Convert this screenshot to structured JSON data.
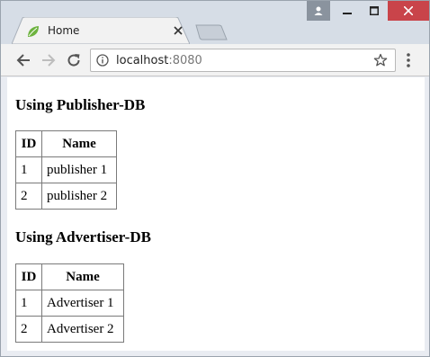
{
  "browser": {
    "tab_title": "Home",
    "url_host": "localhost",
    "url_port": ":8080"
  },
  "sections": [
    {
      "heading": "Using Publisher-DB",
      "columns": [
        "ID",
        "Name"
      ],
      "rows": [
        [
          "1",
          "publisher 1"
        ],
        [
          "2",
          "publisher 2"
        ]
      ]
    },
    {
      "heading": "Using Advertiser-DB",
      "columns": [
        "ID",
        "Name"
      ],
      "rows": [
        [
          "1",
          "Advertiser 1"
        ],
        [
          "2",
          "Advertiser 2"
        ]
      ]
    }
  ],
  "icons": {
    "favicon": "leaf-icon",
    "back": "arrow-left-icon",
    "forward": "arrow-right-icon",
    "reload": "reload-icon",
    "info": "info-icon",
    "bookmark": "star-icon",
    "menu": "kebab-menu-icon"
  },
  "colors": {
    "close_button": "#c9444a",
    "favicon": "#6db33f"
  }
}
